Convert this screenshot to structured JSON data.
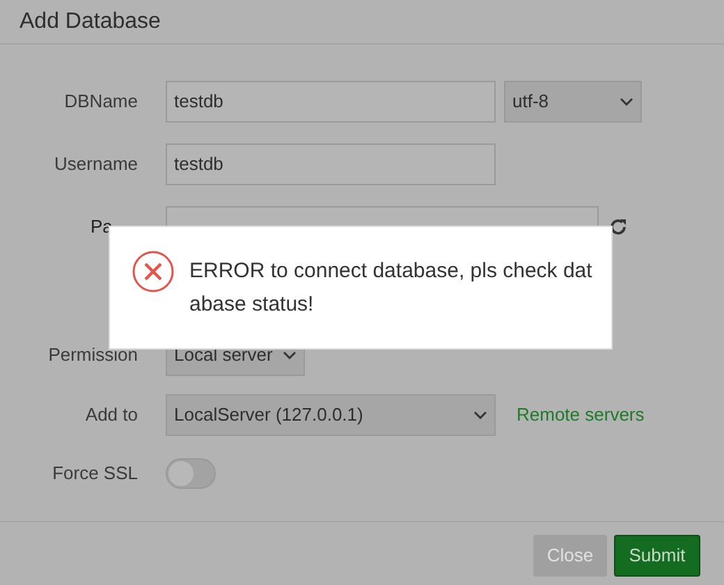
{
  "dialog": {
    "title": "Add Database",
    "fields": [
      {
        "kind": "text",
        "label": "DBName",
        "value": "testdb",
        "select": {
          "value": "utf-8"
        }
      },
      {
        "kind": "text",
        "label": "Username",
        "value": "testdb"
      },
      {
        "kind": "password",
        "label": "Pa"
      },
      {
        "kind": "select",
        "label": "Permission",
        "value": "Local server"
      },
      {
        "kind": "select",
        "label": "Add to",
        "value": "LocalServer (127.0.0.1)",
        "link": "Remote servers"
      },
      {
        "kind": "toggle",
        "label": "Force SSL",
        "on": false
      }
    ],
    "buttons": [
      {
        "label": "Close",
        "kind": "secondary"
      },
      {
        "label": "Submit",
        "kind": "primary"
      }
    ]
  },
  "alert": {
    "kind": "error",
    "message": "ERROR to connect database, pls check dat abase status!"
  }
}
